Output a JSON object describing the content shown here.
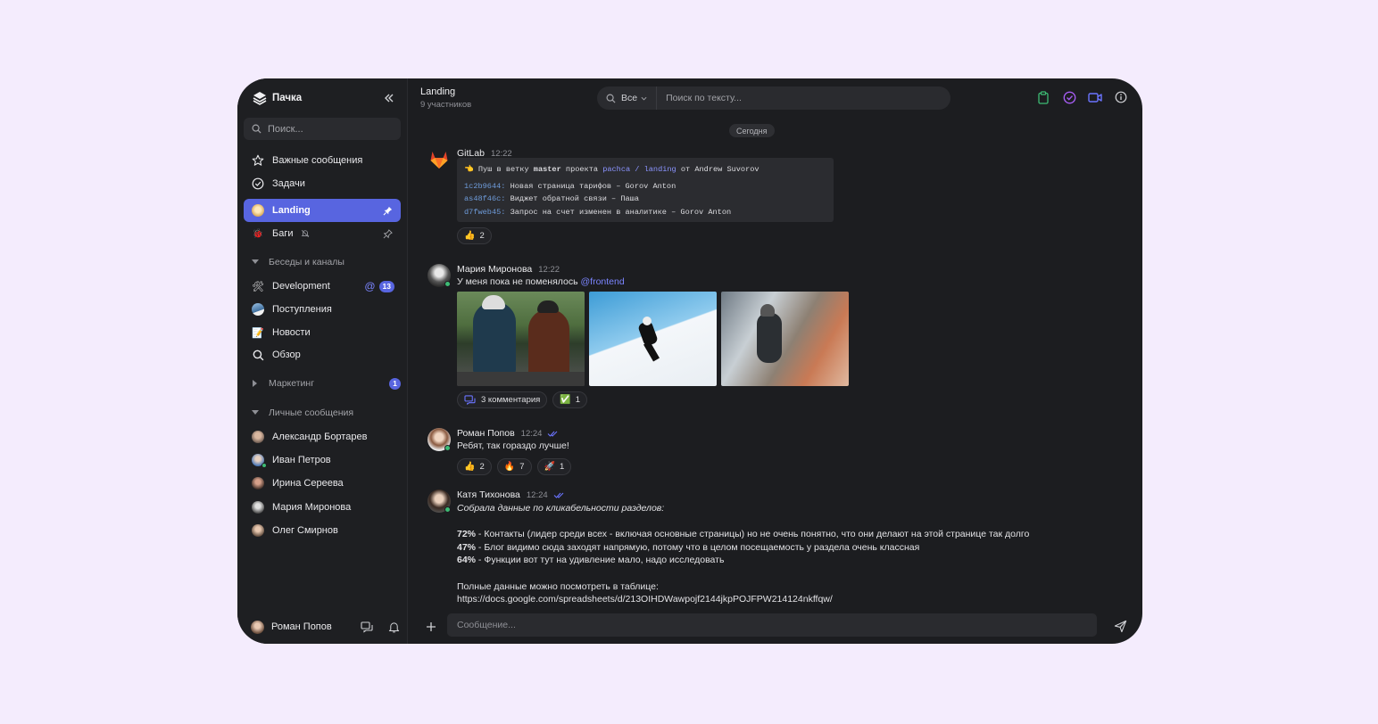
{
  "sidebar": {
    "app_name": "Пачка",
    "search_placeholder": "Поиск...",
    "items": [
      {
        "label": "Важные сообщения",
        "icon": "star-icon"
      },
      {
        "label": "Задачи",
        "icon": "check-circle-icon"
      }
    ],
    "pinned": [
      {
        "label": "Landing",
        "active": true
      },
      {
        "label": "Баги",
        "muted": true
      }
    ],
    "channels_header": "Беседы и каналы",
    "channels": [
      {
        "label": "Development",
        "mention": "@",
        "badge": "13"
      },
      {
        "label": "Поступления"
      },
      {
        "label": "Новости"
      },
      {
        "label": "Обзор"
      }
    ],
    "marketing_header": "Маркетинг",
    "marketing_badge": "1",
    "dm_header": "Личные сообщения",
    "dms": [
      {
        "label": "Александр Бортарев"
      },
      {
        "label": "Иван Петров"
      },
      {
        "label": "Ирина Сереева"
      },
      {
        "label": "Мария Миронова"
      },
      {
        "label": "Олег Смирнов"
      }
    ],
    "current_user": "Роман Попов"
  },
  "header": {
    "title": "Landing",
    "subtitle": "9 участников",
    "filter_label": "Все",
    "search_placeholder": "Поиск по тексту..."
  },
  "date_separator": "Сегодня",
  "messages": {
    "gitlab": {
      "author": "GitLab",
      "time": "12:22",
      "push_emoji": "👈",
      "push_a": "Пуш в ветку",
      "push_branch": "master",
      "push_b": "проекта",
      "push_project": "pachca / landing",
      "push_c": "от Andrew Suvorov",
      "commits": [
        {
          "hash": "1c2b9644:",
          "text": "Новая страница тарифов – Gorov Anton"
        },
        {
          "hash": "as48f46c:",
          "text": "Виджет обратной связи – Паша"
        },
        {
          "hash": "d7fweb45:",
          "text": "Запрос на счет изменен в аналитике – Gorov Anton"
        }
      ],
      "reactions": [
        {
          "emoji": "👍",
          "count": "2"
        }
      ]
    },
    "maria": {
      "author": "Мария Миронова",
      "time": "12:22",
      "text": "У меня пока не поменялось",
      "mention": "@frontend",
      "comments": "3 комментария",
      "reactions": [
        {
          "emoji": "✅",
          "count": "1"
        }
      ]
    },
    "roman": {
      "author": "Роман Попов",
      "time": "12:24",
      "text": "Ребят, так гораздо лучше!",
      "reactions": [
        {
          "emoji": "👍",
          "count": "2"
        },
        {
          "emoji": "🔥",
          "count": "7"
        },
        {
          "emoji": "🚀",
          "count": "1"
        }
      ]
    },
    "katya": {
      "author": "Катя Тихонова",
      "time": "12:24",
      "intro": "Собрала данные по кликабельности разделов:",
      "stats": [
        {
          "pct": "72%",
          "text": " - Контакты (лидер среди всех - включая основные страницы) но не очень понятно, что они делают на этой странице так долго"
        },
        {
          "pct": "47%",
          "text": " - Блог видимо сюда заходят напрямую, потому что в целом посещаемость у раздела очень классная"
        },
        {
          "pct": "64%",
          "text": " - Функции вот тут на удивление мало, надо исследовать"
        }
      ],
      "outro": "Полные данные можно посмотреть в таблице:",
      "link": "https://docs.google.com/spreadsheets/d/213OIHDWawpojf2144jkpPOJFPW214124nkffqw/"
    }
  },
  "composer": {
    "placeholder": "Сообщение..."
  },
  "colors": {
    "accent": "#5865e0",
    "online": "#3dbb74",
    "background": "#1c1d20",
    "page": "#f4ecfd"
  }
}
